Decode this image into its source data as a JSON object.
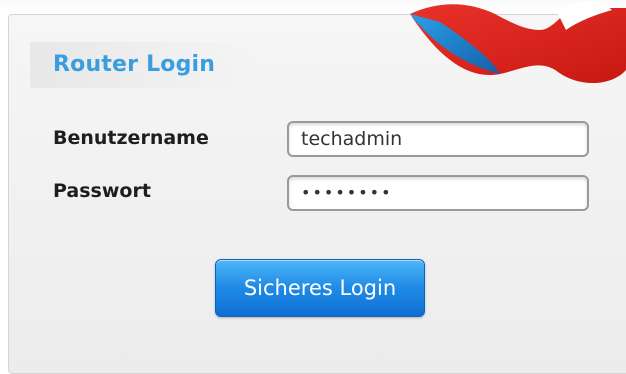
{
  "form": {
    "title": "Router Login",
    "username_label": "Benutzername",
    "username_value": "techadmin",
    "password_label": "Passwort",
    "password_value": "••••••••",
    "submit_label": "Sicheres Login"
  },
  "colors": {
    "title": "#3a9de0",
    "button": "#1e8ae6",
    "logo_red": "#e2241f",
    "logo_blue": "#1f8fd8"
  }
}
